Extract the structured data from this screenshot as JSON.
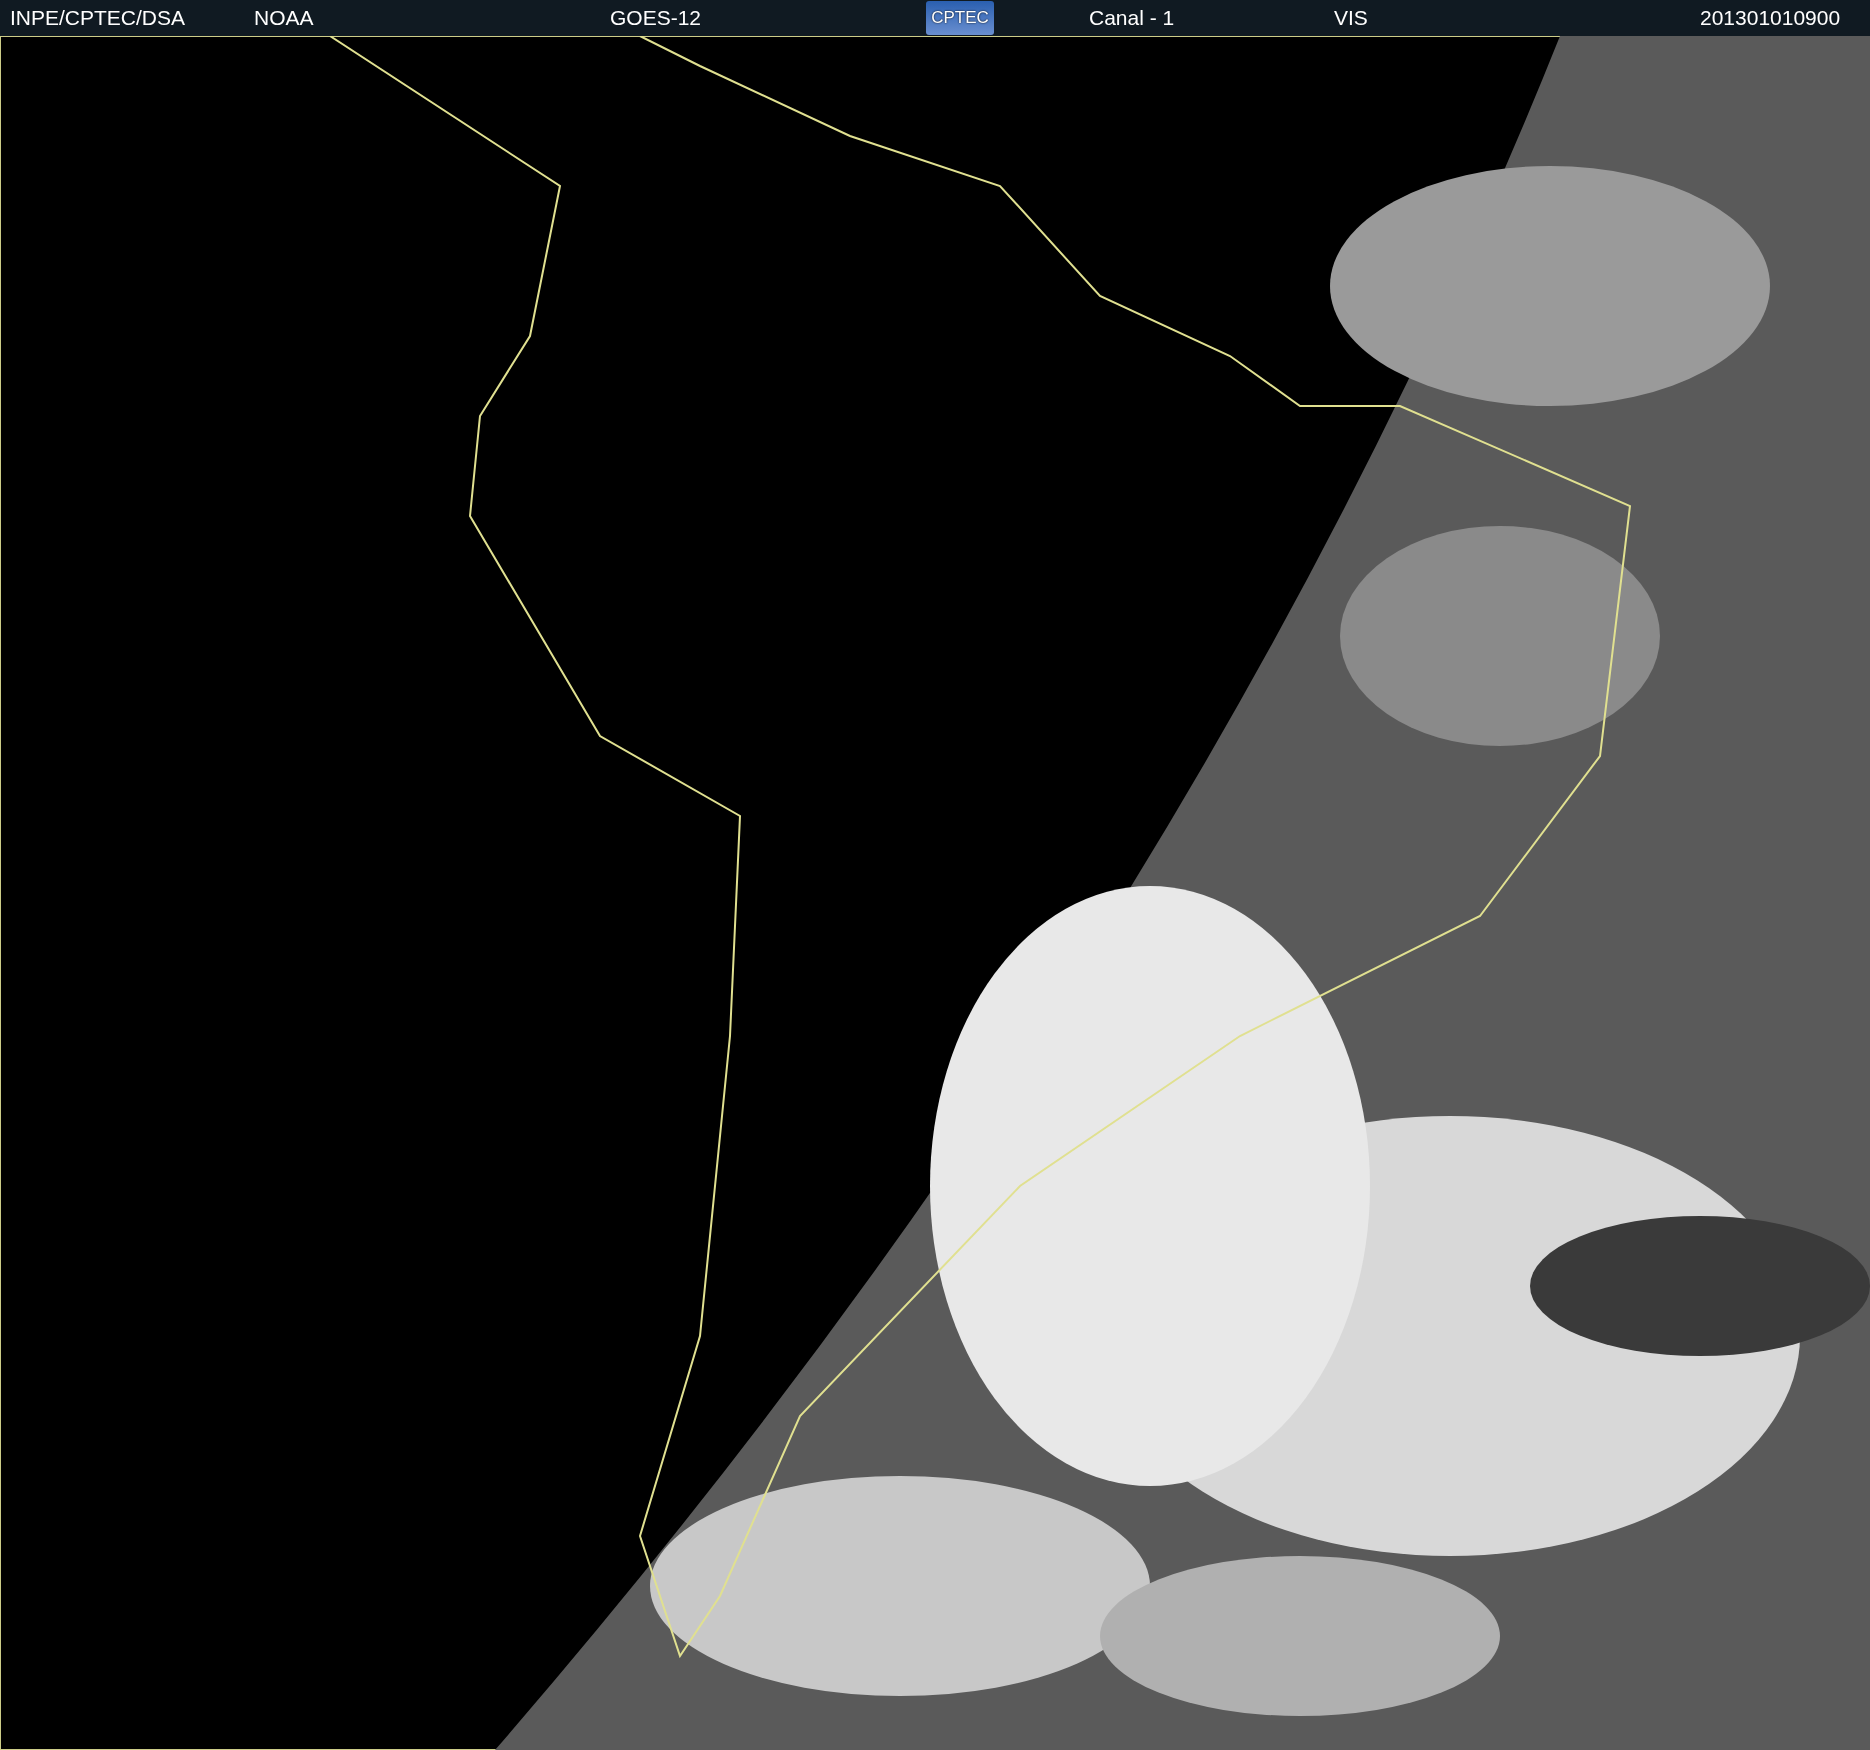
{
  "header": {
    "agency": "INPE/CPTEC/DSA",
    "source": "NOAA",
    "satellite": "GOES-12",
    "logo": "CPTEC",
    "channel": "Canal - 1",
    "band": "VIS",
    "timestamp": "201301010900"
  }
}
